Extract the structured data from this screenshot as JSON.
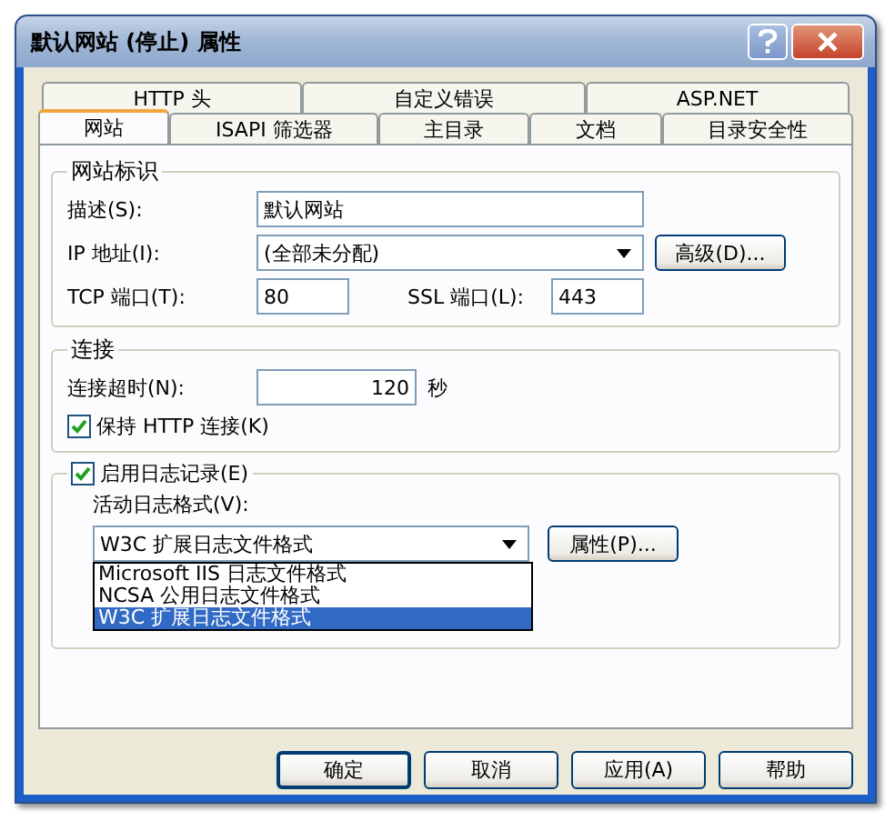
{
  "window": {
    "title": "默认网站 (停止) 属性"
  },
  "tab_rows": [
    [
      {
        "label": "HTTP 头",
        "selected": false
      },
      {
        "label": "自定义错误",
        "selected": false
      },
      {
        "label": "ASP.NET",
        "selected": false
      }
    ],
    [
      {
        "label": "网站",
        "selected": true
      },
      {
        "label": "ISAPI 筛选器",
        "selected": false
      },
      {
        "label": "主目录",
        "selected": false
      },
      {
        "label": "文档",
        "selected": false
      },
      {
        "label": "目录安全性",
        "selected": false
      }
    ]
  ],
  "identification": {
    "title": "网站标识",
    "description": {
      "label": "描述(S):",
      "value": "默认网站"
    },
    "ip": {
      "label": "IP 地址(I):",
      "value": "(全部未分配)",
      "button": "高级(D)..."
    },
    "tcp_port": {
      "label": "TCP 端口(T):",
      "value": "80"
    },
    "ssl_port": {
      "label": "SSL 端口(L):",
      "value": "443"
    }
  },
  "connection": {
    "title": "连接",
    "timeout": {
      "label": "连接超时(N):",
      "value": "120",
      "unit": "秒"
    },
    "keep_alive": {
      "label": "保持 HTTP 连接(K)",
      "checked": true
    }
  },
  "logging": {
    "label": "启用日志记录(E)",
    "checked": true,
    "format_label": "活动日志格式(V):",
    "format_value": "W3C 扩展日志文件格式",
    "expanded": true,
    "options": [
      {
        "label": "Microsoft IIS 日志文件格式",
        "selected": false
      },
      {
        "label": "NCSA 公用日志文件格式",
        "selected": false
      },
      {
        "label": "W3C 扩展日志文件格式",
        "selected": true
      }
    ],
    "button": "属性(P)..."
  },
  "buttons": [
    {
      "label": "确定",
      "default": true
    },
    {
      "label": "取消",
      "default": false
    },
    {
      "label": "应用(A)",
      "default": false
    },
    {
      "label": "帮助",
      "default": false
    }
  ]
}
